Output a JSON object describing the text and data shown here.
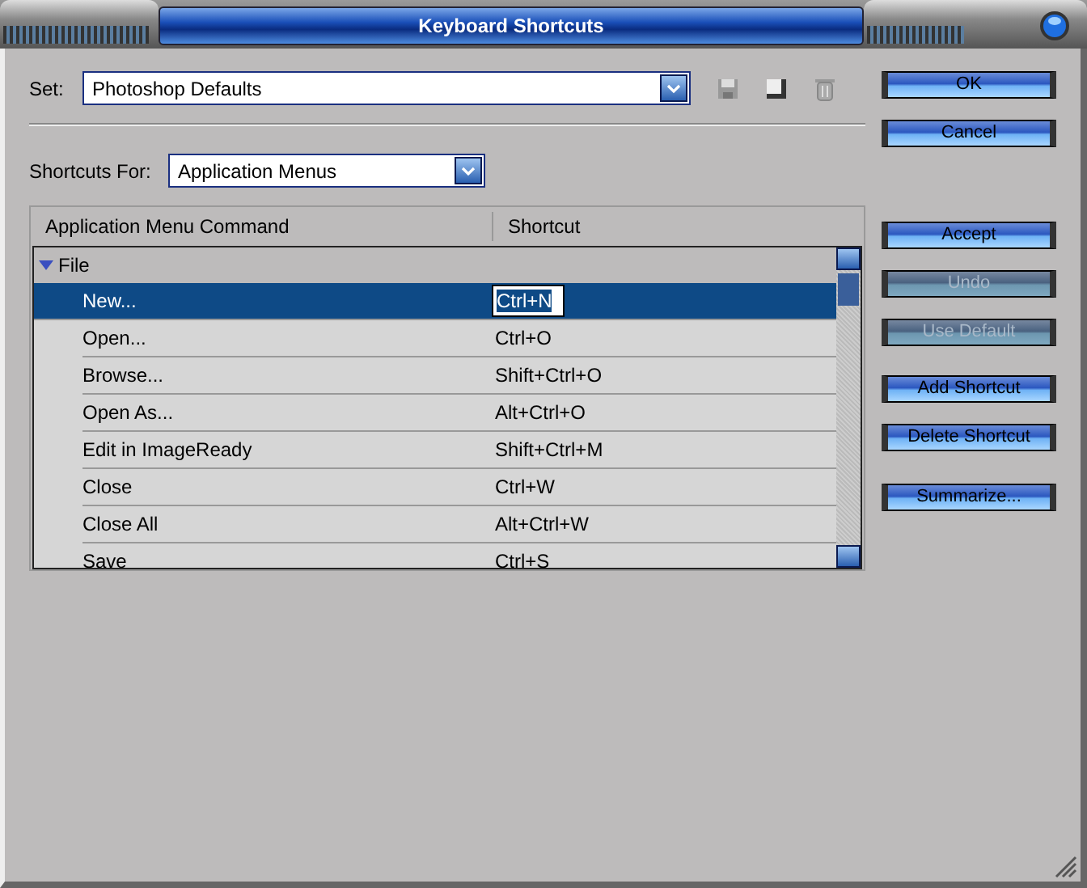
{
  "window": {
    "title": "Keyboard Shortcuts"
  },
  "set": {
    "label": "Set:",
    "value": "Photoshop Defaults"
  },
  "shortcuts_for": {
    "label": "Shortcuts For:",
    "value": "Application Menus"
  },
  "table": {
    "columns": [
      "Application Menu Command",
      "Shortcut"
    ],
    "groups": [
      {
        "label": "File",
        "expanded": true,
        "children": [
          {
            "command": "New...",
            "shortcut": "Ctrl+N",
            "selected": true
          },
          {
            "command": "Open...",
            "shortcut": "Ctrl+O",
            "selected": false
          },
          {
            "command": "Browse...",
            "shortcut": "Shift+Ctrl+O",
            "selected": false
          },
          {
            "command": "Open As...",
            "shortcut": "Alt+Ctrl+O",
            "selected": false
          },
          {
            "command": "Edit in ImageReady",
            "shortcut": "Shift+Ctrl+M",
            "selected": false
          },
          {
            "command": "Close",
            "shortcut": "Ctrl+W",
            "selected": false
          },
          {
            "command": "Close All",
            "shortcut": "Alt+Ctrl+W",
            "selected": false
          },
          {
            "command": "Save",
            "shortcut": "Ctrl+S",
            "selected": false
          }
        ]
      }
    ]
  },
  "button_groups": [
    [
      {
        "label": "OK",
        "disabled": false
      },
      {
        "label": "Cancel",
        "disabled": false
      }
    ],
    [
      {
        "label": "Accept",
        "disabled": false
      },
      {
        "label": "Undo",
        "disabled": true
      },
      {
        "label": "Use Default",
        "disabled": true
      }
    ],
    [
      {
        "label": "Add Shortcut",
        "disabled": false
      },
      {
        "label": "Delete Shortcut",
        "disabled": false
      }
    ],
    [
      {
        "label": "Summarize...",
        "disabled": false
      }
    ]
  ]
}
